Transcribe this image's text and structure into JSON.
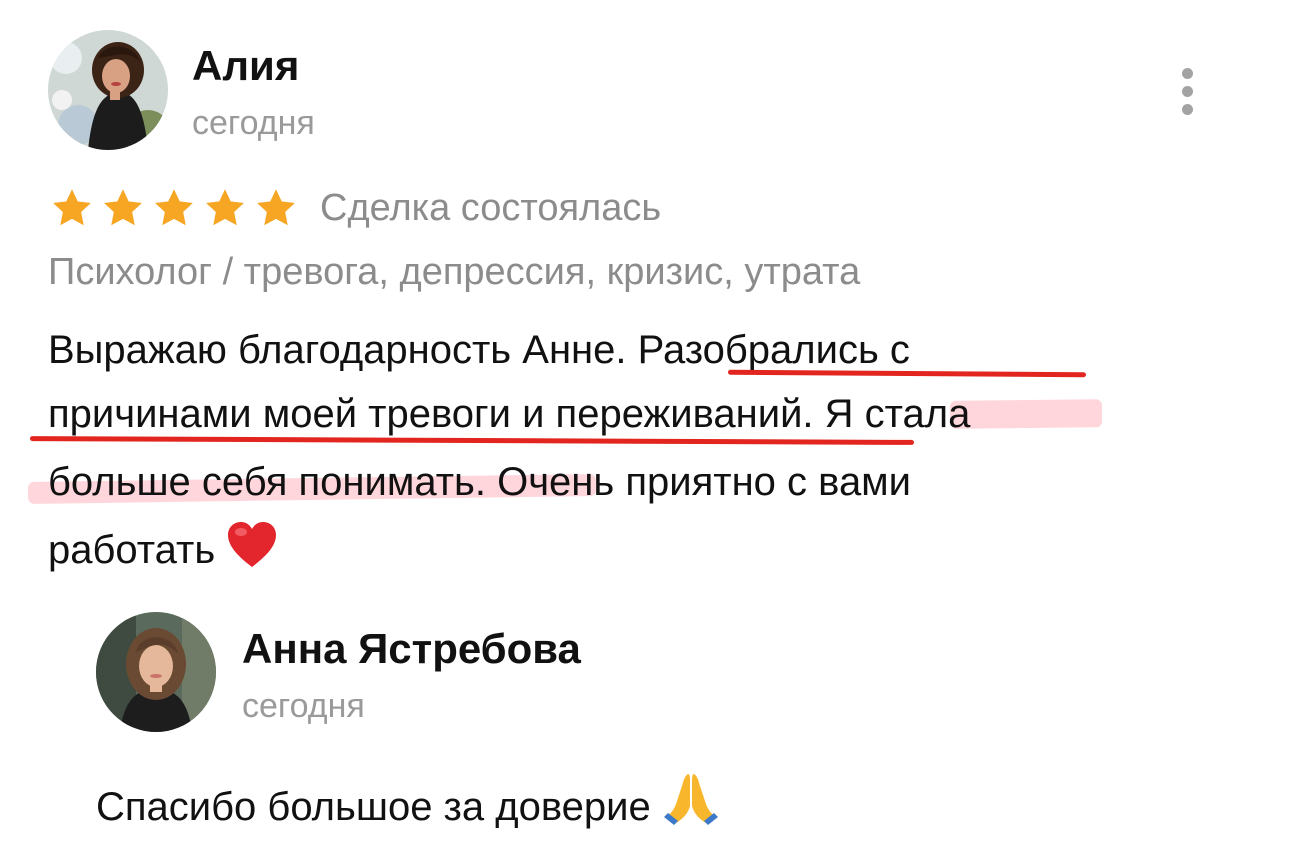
{
  "review": {
    "author": {
      "name": "Алия",
      "date": "сегодня",
      "avatar": "reviewer-avatar-photo"
    },
    "menu_icon": "more-vertical-icon",
    "rating": 5,
    "rating_max": 5,
    "star_color": "#f6a623",
    "deal_status": "Сделка состоялась",
    "category": "Психолог / тревога, депрессия, кризис, утрата",
    "text": {
      "line1_plain": "Выражаю благодарность Анне. ",
      "line1_marked": "Разобрались с",
      "line2_marked": "причинами моей тревоги и переживаний",
      "line2_plain": ". Я стала",
      "line3_marked": "больше себя понимать",
      "line3_plain": ". Очень приятно с вами",
      "line4_plain": "работать ",
      "emoji": "❤️"
    },
    "annotation_colors": {
      "underline": "#e2261f",
      "highlight": "#ff788c"
    }
  },
  "reply": {
    "author": {
      "name": "Анна Ястребова",
      "date": "сегодня",
      "avatar": "seller-avatar-photo"
    },
    "text": "Спасибо большое за доверие ",
    "emoji": "🙏"
  }
}
